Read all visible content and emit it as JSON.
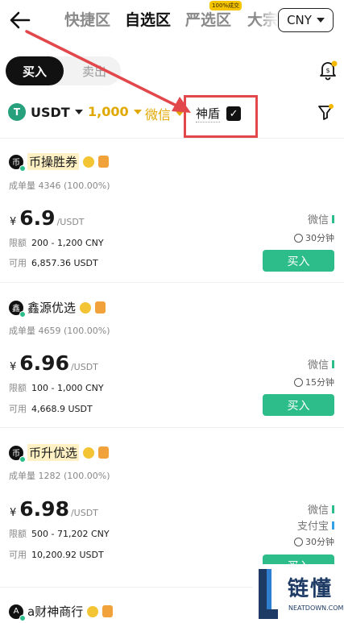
{
  "header": {
    "tabs": [
      {
        "label": "快捷区"
      },
      {
        "label": "自选区"
      },
      {
        "label": "严选区",
        "badge": "100%成交"
      }
    ],
    "clipped_tab": "大宗",
    "currency": "CNY"
  },
  "trade_toggle": {
    "buy": "买入",
    "sell": "卖出"
  },
  "filters": {
    "asset": "USDT",
    "asset_icon": "T",
    "amount": "1,000",
    "payment": "微信",
    "shield_label": "神盾",
    "shield_checked": true
  },
  "listing_labels": {
    "volume": "成单量",
    "limit": "限额",
    "available": "可用",
    "price_unit": "/USDT",
    "currency_symbol": "¥",
    "buy": "买入"
  },
  "listings": [
    {
      "merchant": "币操胜券",
      "avatar": "币",
      "volume": "4346 (100.00%)",
      "price": "6.9",
      "limit": "200 - 1,200 CNY",
      "available": "6,857.36 USDT",
      "payments": [
        "微信"
      ],
      "time": "30分钟"
    },
    {
      "merchant": "鑫源优选",
      "avatar": "鑫",
      "volume": "4659 (100.00%)",
      "price": "6.96",
      "limit": "100 - 1,000 CNY",
      "available": "4,668.9 USDT",
      "payments": [
        "微信"
      ],
      "time": "15分钟"
    },
    {
      "merchant": "币升优选",
      "avatar": "币",
      "volume": "1282 (100.00%)",
      "price": "6.98",
      "limit": "500 - 71,202 CNY",
      "available": "10,200.92 USDT",
      "payments": [
        "微信",
        "支付宝"
      ],
      "time": "30分钟"
    },
    {
      "merchant": "a财神商行",
      "avatar": "A"
    }
  ],
  "watermark": {
    "title": "链懂",
    "domain": "NEATDOWN.COM"
  },
  "colors": {
    "accent_green": "#2dbd8a",
    "highlight_red": "#e1474b",
    "filter_gold": "#e0a800"
  }
}
